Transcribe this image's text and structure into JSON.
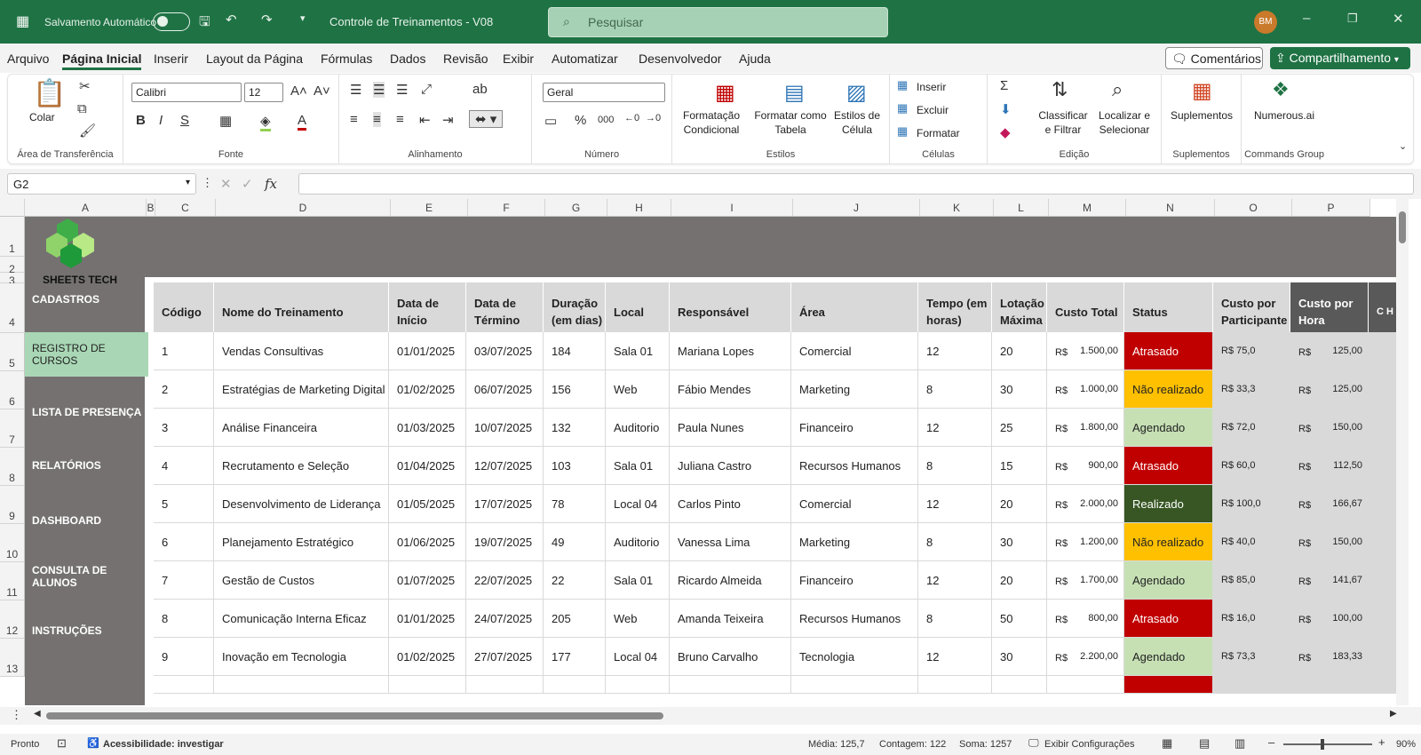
{
  "titlebar": {
    "autosave_label": "Salvamento Automático",
    "doc_title": "Controle de Treinamentos - V08",
    "search_placeholder": "Pesquisar",
    "avatar": "BM"
  },
  "menu": {
    "items": [
      "Arquivo",
      "Página Inicial",
      "Inserir",
      "Layout da Página",
      "Fórmulas",
      "Dados",
      "Revisão",
      "Exibir",
      "Automatizar",
      "Desenvolvedor",
      "Ajuda"
    ],
    "comments": "Comentários",
    "share": "Compartilhamento"
  },
  "ribbon": {
    "clipboard": {
      "paste": "Colar",
      "label": "Área de Transferência"
    },
    "font": {
      "name": "Calibri",
      "size": "12",
      "label": "Fonte"
    },
    "alignment": {
      "label": "Alinhamento"
    },
    "number": {
      "format": "Geral",
      "label": "Número"
    },
    "styles": {
      "cond": "Formatação Condicional",
      "table": "Formatar como Tabela",
      "cell": "Estilos de Célula",
      "label": "Estilos"
    },
    "cells": {
      "insert": "Inserir",
      "delete": "Excluir",
      "format": "Formatar",
      "label": "Células"
    },
    "editing": {
      "sort": "Classificar e Filtrar",
      "find": "Localizar e Selecionar",
      "label": "Edição"
    },
    "addins": {
      "btn": "Suplementos",
      "label": "Suplementos"
    },
    "commands": {
      "btn": "Numerous.ai",
      "label": "Commands Group"
    }
  },
  "formula_bar": {
    "name_box": "G2",
    "fx": "fx",
    "value": ""
  },
  "columns": [
    "A",
    "B",
    "C",
    "D",
    "E",
    "F",
    "G",
    "H",
    "I",
    "J",
    "K",
    "L",
    "M",
    "N",
    "O",
    "P"
  ],
  "rows": [
    "1",
    "2",
    "3",
    "4",
    "5",
    "6",
    "7",
    "8",
    "9",
    "10",
    "11",
    "12",
    "13"
  ],
  "logo_text": "SHEETS TECH",
  "nav": [
    "CADASTROS",
    "REGISTRO DE CURSOS",
    "LISTA DE PRESENÇA",
    "RELATÓRIOS",
    "DASHBOARD",
    "CONSULTA DE ALUNOS",
    "INSTRUÇÕES"
  ],
  "table": {
    "headers": [
      "Código",
      "Nome do Treinamento",
      "Data de Início",
      "Data de Término",
      "Duração (em dias)",
      "Local",
      "Responsável",
      "Área",
      "Tempo (em horas)",
      "Lotação Máxima",
      "Custo Total",
      "Status",
      "Custo por Participante",
      "Custo por Hora",
      "C H P"
    ],
    "rows": [
      [
        "1",
        "Vendas Consultivas",
        "01/01/2025",
        "03/07/2025",
        "184",
        "Sala 01",
        "Mariana Lopes",
        "Comercial",
        "12",
        "20",
        "1.500,00",
        "Atrasado",
        "R$ 75,0",
        "125,00"
      ],
      [
        "2",
        "Estratégias de Marketing Digital",
        "01/02/2025",
        "06/07/2025",
        "156",
        "Web",
        "Fábio Mendes",
        "Marketing",
        "8",
        "30",
        "1.000,00",
        "Não realizado",
        "R$ 33,3",
        "125,00"
      ],
      [
        "3",
        "Análise Financeira",
        "01/03/2025",
        "10/07/2025",
        "132",
        "Auditorio",
        "Paula Nunes",
        "Financeiro",
        "12",
        "25",
        "1.800,00",
        "Agendado",
        "R$ 72,0",
        "150,00"
      ],
      [
        "4",
        "Recrutamento e Seleção",
        "01/04/2025",
        "12/07/2025",
        "103",
        "Sala 01",
        "Juliana Castro",
        "Recursos Humanos",
        "8",
        "15",
        "900,00",
        "Atrasado",
        "R$ 60,0",
        "112,50"
      ],
      [
        "5",
        "Desenvolvimento de Liderança",
        "01/05/2025",
        "17/07/2025",
        "78",
        "Local 04",
        "Carlos Pinto",
        "Comercial",
        "12",
        "20",
        "2.000,00",
        "Realizado",
        "R$ 100,0",
        "166,67"
      ],
      [
        "6",
        "Planejamento Estratégico",
        "01/06/2025",
        "19/07/2025",
        "49",
        "Auditorio",
        "Vanessa Lima",
        "Marketing",
        "8",
        "30",
        "1.200,00",
        "Não realizado",
        "R$ 40,0",
        "150,00"
      ],
      [
        "7",
        "Gestão de Custos",
        "01/07/2025",
        "22/07/2025",
        "22",
        "Sala 01",
        "Ricardo Almeida",
        "Financeiro",
        "12",
        "20",
        "1.700,00",
        "Agendado",
        "R$ 85,0",
        "141,67"
      ],
      [
        "8",
        "Comunicação Interna Eficaz",
        "01/01/2025",
        "24/07/2025",
        "205",
        "Web",
        "Amanda Teixeira",
        "Recursos Humanos",
        "8",
        "50",
        "800,00",
        "Atrasado",
        "R$ 16,0",
        "100,00"
      ],
      [
        "9",
        "Inovação em Tecnologia",
        "01/02/2025",
        "27/07/2025",
        "177",
        "Local 04",
        "Bruno Carvalho",
        "Tecnologia",
        "12",
        "30",
        "2.200,00",
        "Agendado",
        "R$ 73,3",
        "183,33"
      ]
    ],
    "currency": "R$"
  },
  "status_colors": {
    "Atrasado": "#c00000",
    "Não realizado": "#ffc000",
    "Agendado": "#c6e0b4",
    "Realizado": "#375623"
  },
  "statusbar": {
    "ready": "Pronto",
    "accessibility": "Acessibilidade: investigar",
    "avg": "Média: 125,7",
    "count": "Contagem: 122",
    "sum": "Soma: 1257",
    "view_settings": "Exibir Configurações",
    "zoom": "90%"
  }
}
